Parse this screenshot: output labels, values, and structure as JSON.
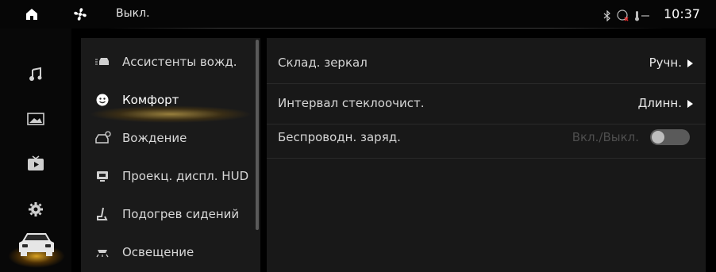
{
  "status_bar": {
    "climate_text": "Выкл.",
    "time": "10:37",
    "icons": [
      "home-icon",
      "fan-icon",
      "bluetooth-icon",
      "no-signal-icon",
      "temperature-icon"
    ]
  },
  "left_rail": {
    "items": [
      {
        "name": "music-icon"
      },
      {
        "name": "gallery-icon"
      },
      {
        "name": "video-icon"
      },
      {
        "name": "settings-gear-icon"
      },
      {
        "name": "car-icon",
        "active": true
      }
    ]
  },
  "menu": {
    "items": [
      {
        "label": "Ассистенты вожд.",
        "icon": "driver-assist-icon"
      },
      {
        "label": "Комфорт",
        "icon": "comfort-icon",
        "active": true
      },
      {
        "label": "Вождение",
        "icon": "driving-icon"
      },
      {
        "label": "Проекц. диспл. HUD",
        "icon": "hud-icon"
      },
      {
        "label": "Подогрев сидений",
        "icon": "seat-heating-icon"
      },
      {
        "label": "Освещение",
        "icon": "lighting-icon"
      }
    ]
  },
  "settings": {
    "rows": [
      {
        "label": "Склад. зеркал",
        "value": "Ручн."
      },
      {
        "label": "Интервал стеклоочист.",
        "value": "Длинн."
      },
      {
        "label": "Беспроводн. заряд.",
        "value": "Вкл./Выкл.",
        "toggle": false
      }
    ]
  },
  "colors": {
    "accent": "#ffc24a",
    "background": "#000000",
    "panel": "#1a1a1a"
  }
}
